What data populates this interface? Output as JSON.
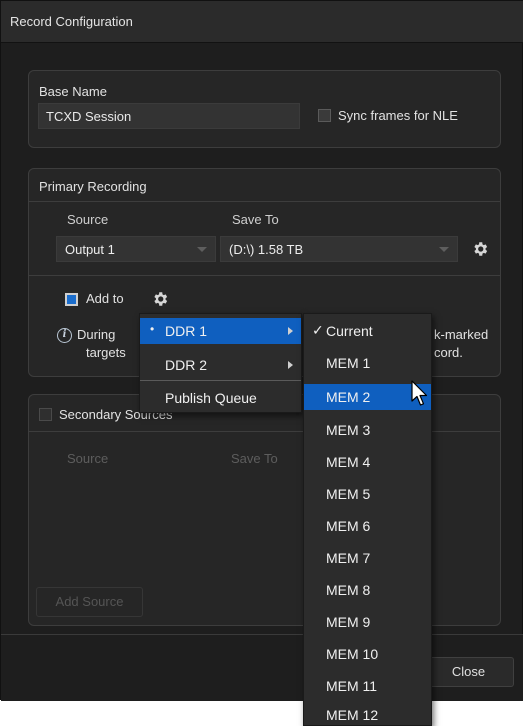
{
  "window": {
    "title": "Record Configuration"
  },
  "base_name": {
    "label": "Base Name",
    "value": "TCXD Session",
    "sync_label": "Sync frames for NLE",
    "sync_checked": false
  },
  "primary": {
    "title": "Primary Recording",
    "source_label": "Source",
    "source_value": "Output 1",
    "save_to_label": "Save To",
    "save_to_value": "(D:\\) 1.58 TB",
    "add_to_label": "Add to",
    "add_to_checked": true,
    "info_left_1": "During",
    "info_left_2": "targets",
    "info_right_1": "k-marked",
    "info_right_2": "cord."
  },
  "secondary": {
    "title_visible": "Secondary Sources",
    "source_label": "Source",
    "save_to_label": "Save To",
    "add_source_label": "Add Source"
  },
  "footer": {
    "close_label": "Close"
  },
  "menu_primary": {
    "items": [
      {
        "label": "DDR 1",
        "bullet": "•",
        "highlighted": true,
        "has_submenu": true
      },
      {
        "label": "DDR 2",
        "bullet": "",
        "highlighted": false,
        "has_submenu": true
      },
      {
        "label": "Publish Queue",
        "bullet": "",
        "highlighted": false,
        "has_submenu": false
      }
    ]
  },
  "menu_submenu": {
    "check_glyph": "✓",
    "items": [
      {
        "label": "Current",
        "checked": true,
        "highlighted": false
      },
      {
        "label": "MEM 1",
        "checked": false,
        "highlighted": false
      },
      {
        "label": "MEM 2",
        "checked": false,
        "highlighted": true
      },
      {
        "label": "MEM 3",
        "checked": false,
        "highlighted": false
      },
      {
        "label": "MEM 4",
        "checked": false,
        "highlighted": false
      },
      {
        "label": "MEM 5",
        "checked": false,
        "highlighted": false
      },
      {
        "label": "MEM 6",
        "checked": false,
        "highlighted": false
      },
      {
        "label": "MEM 7",
        "checked": false,
        "highlighted": false
      },
      {
        "label": "MEM 8",
        "checked": false,
        "highlighted": false
      },
      {
        "label": "MEM 9",
        "checked": false,
        "highlighted": false
      },
      {
        "label": "MEM 10",
        "checked": false,
        "highlighted": false
      },
      {
        "label": "MEM 11",
        "checked": false,
        "highlighted": false
      },
      {
        "label": "MEM 12",
        "checked": false,
        "highlighted": false
      }
    ]
  },
  "colors": {
    "highlight": "#0f5fbf",
    "dialog_bg": "#1e1e1e",
    "panel_bg": "#262626"
  },
  "icons": {
    "gear": "gear-icon",
    "info": "info-icon",
    "submenu": "chevron-right-icon",
    "cursor": "mouse-pointer-icon"
  }
}
